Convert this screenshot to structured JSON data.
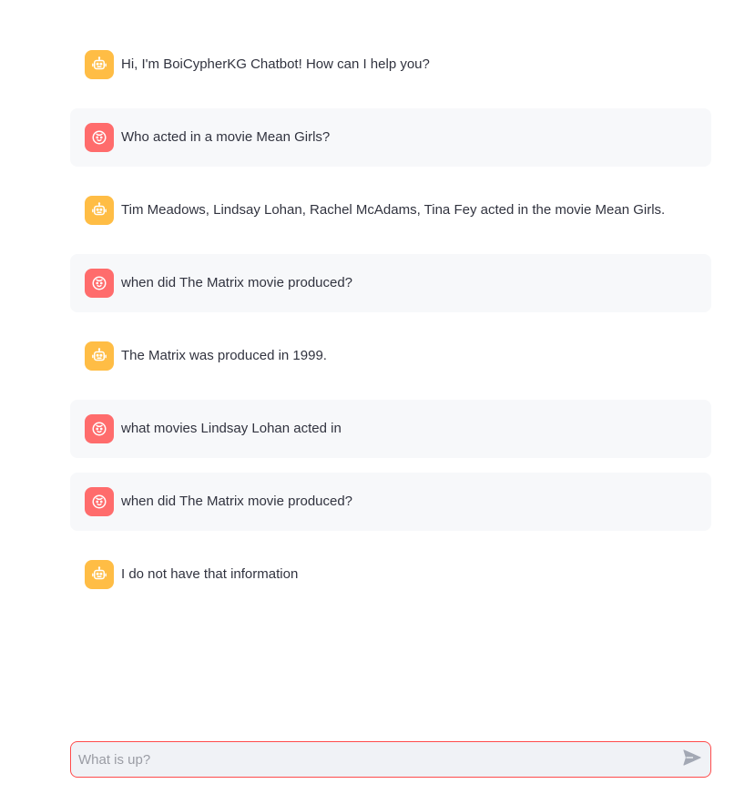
{
  "messages": [
    {
      "role": "assistant",
      "text": "Hi, I'm BoiCypherKG Chatbot! How can I help you?"
    },
    {
      "role": "user",
      "text": "Who acted in a movie Mean Girls?"
    },
    {
      "role": "assistant",
      "text": "Tim Meadows, Lindsay Lohan, Rachel McAdams, Tina Fey acted in the movie Mean Girls."
    },
    {
      "role": "user",
      "text": "when did The Matrix movie produced?"
    },
    {
      "role": "assistant",
      "text": "The Matrix was produced in 1999."
    },
    {
      "role": "user",
      "text": "what movies Lindsay Lohan acted in"
    },
    {
      "role": "user",
      "text": "when did The Matrix movie produced?"
    },
    {
      "role": "assistant",
      "text": "I do not have that information"
    }
  ],
  "chat_input": {
    "placeholder": "What is up?",
    "value": ""
  },
  "icons": {
    "assistant_avatar": "robot-icon",
    "user_avatar": "face-icon",
    "send": "send-icon"
  },
  "colors": {
    "assistant_avatar_bg": "#ffbd45",
    "user_avatar_bg": "#ff6c6c",
    "user_message_bg": "#f7f8fa",
    "input_border": "#ff4b4b",
    "input_bg": "#f0f2f6"
  }
}
